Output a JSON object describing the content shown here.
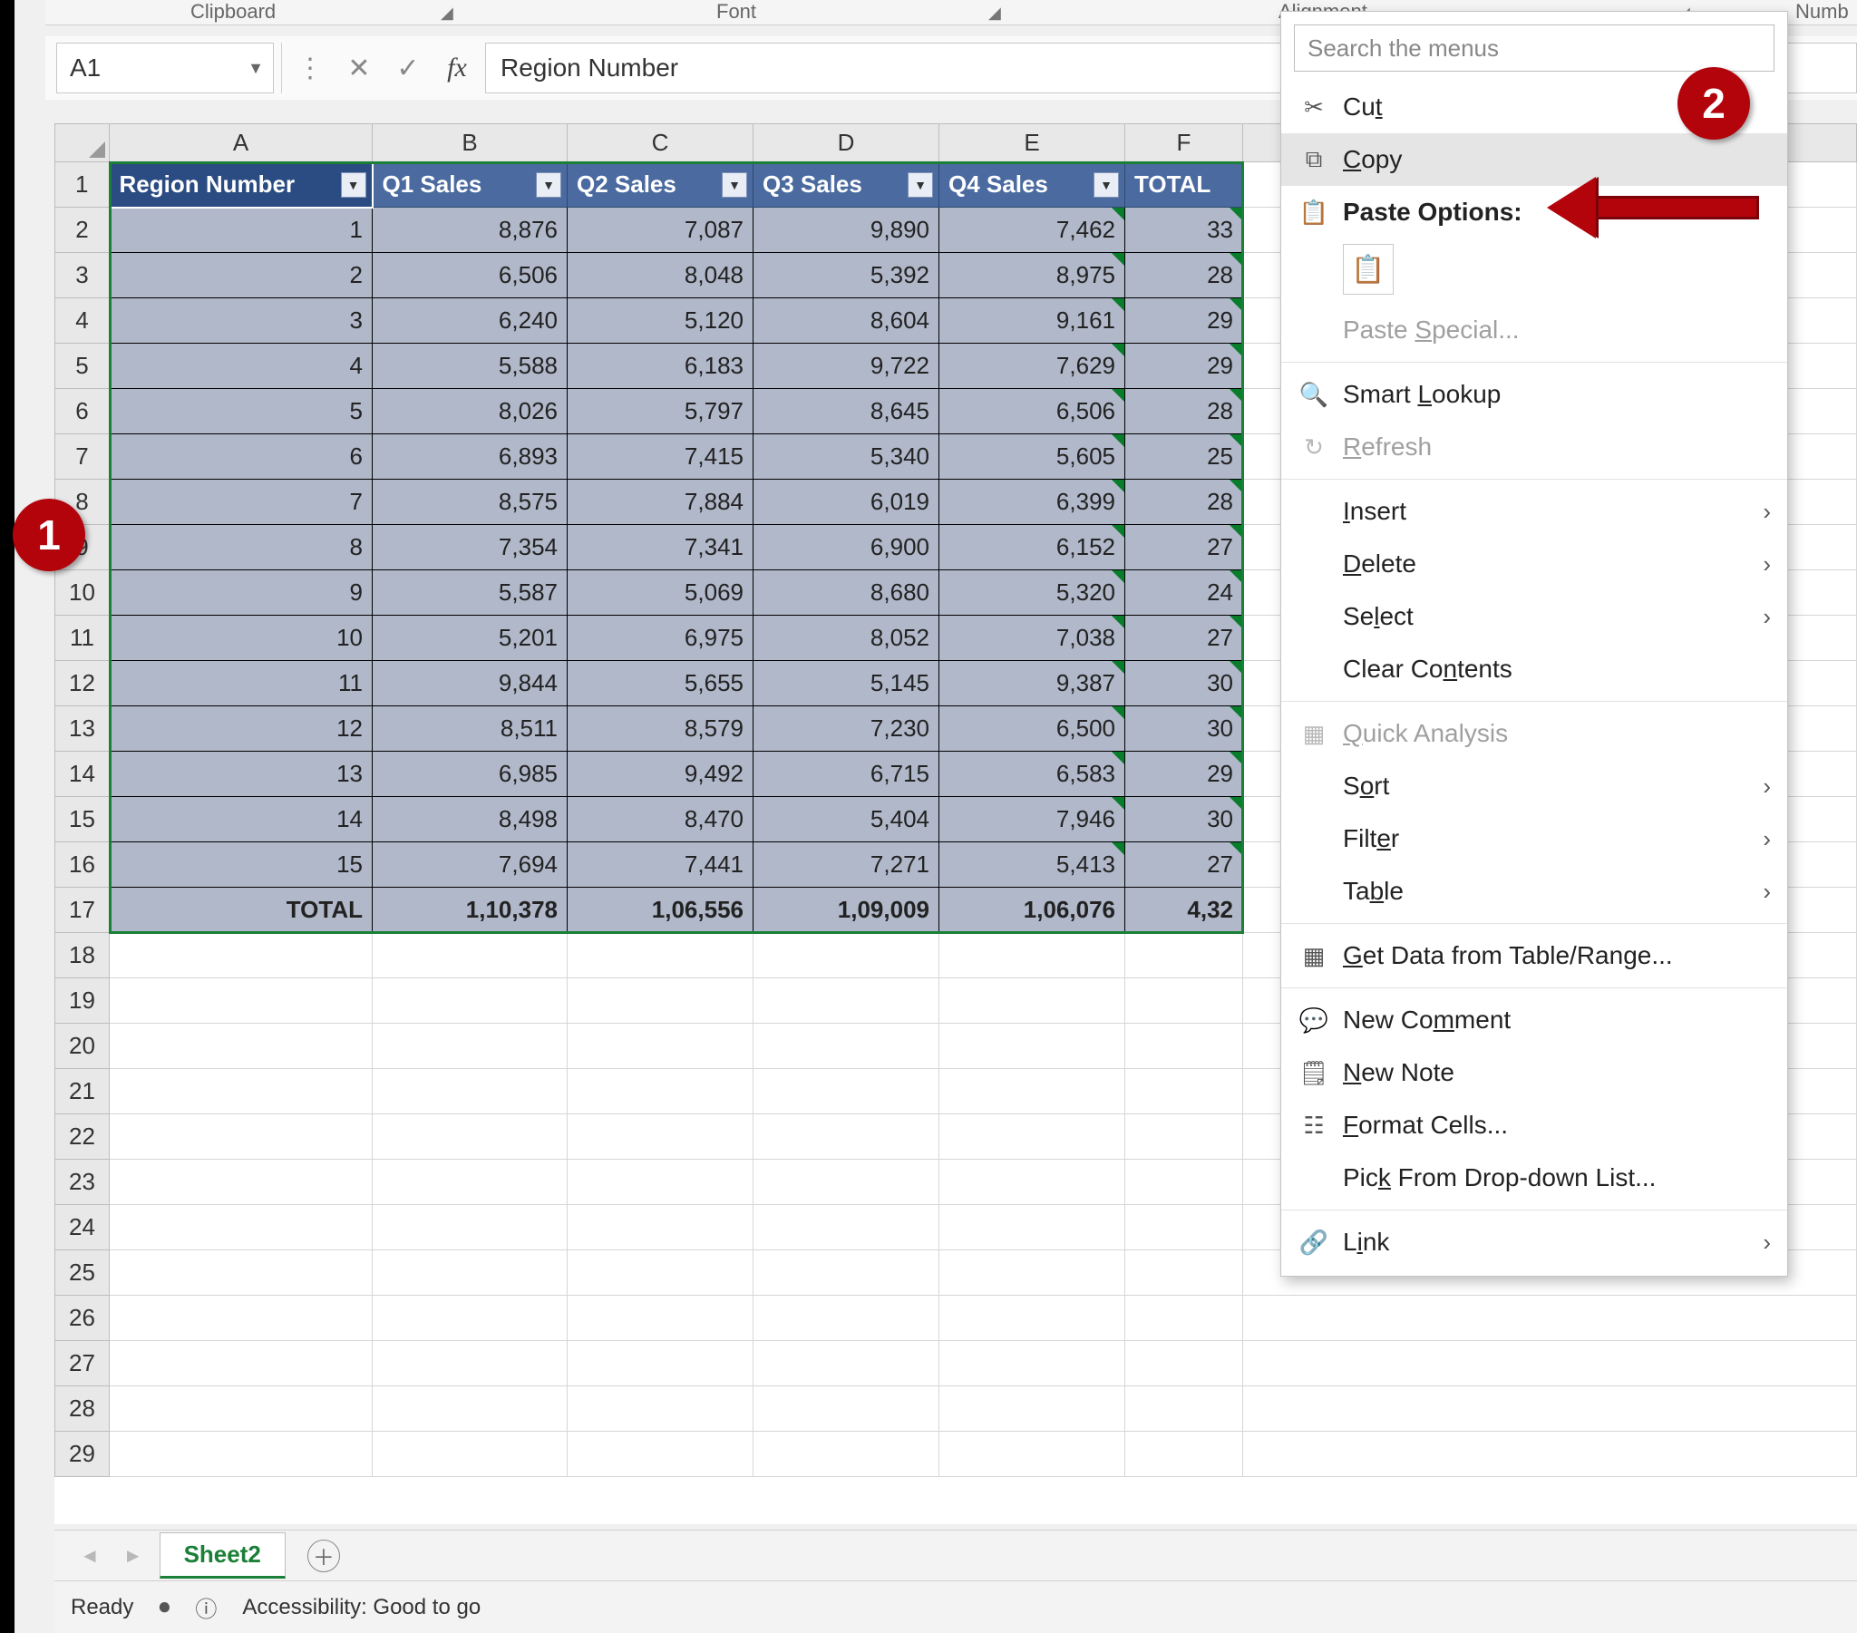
{
  "ribbon": {
    "groups": [
      "Clipboard",
      "Font",
      "Alignment",
      "Numb"
    ]
  },
  "nameBox": "A1",
  "formulaBar": "Region Number",
  "columns": [
    "A",
    "B",
    "C",
    "D",
    "E",
    "F"
  ],
  "tableHeaders": [
    "Region Number",
    "Q1 Sales",
    "Q2 Sales",
    "Q3 Sales",
    "Q4 Sales",
    "TOTAL"
  ],
  "rows": [
    {
      "region": "1",
      "q1": "8,876",
      "q2": "7,087",
      "q3": "9,890",
      "q4": "7,462",
      "total": "33"
    },
    {
      "region": "2",
      "q1": "6,506",
      "q2": "8,048",
      "q3": "5,392",
      "q4": "8,975",
      "total": "28"
    },
    {
      "region": "3",
      "q1": "6,240",
      "q2": "5,120",
      "q3": "8,604",
      "q4": "9,161",
      "total": "29"
    },
    {
      "region": "4",
      "q1": "5,588",
      "q2": "6,183",
      "q3": "9,722",
      "q4": "7,629",
      "total": "29"
    },
    {
      "region": "5",
      "q1": "8,026",
      "q2": "5,797",
      "q3": "8,645",
      "q4": "6,506",
      "total": "28"
    },
    {
      "region": "6",
      "q1": "6,893",
      "q2": "7,415",
      "q3": "5,340",
      "q4": "5,605",
      "total": "25"
    },
    {
      "region": "7",
      "q1": "8,575",
      "q2": "7,884",
      "q3": "6,019",
      "q4": "6,399",
      "total": "28"
    },
    {
      "region": "8",
      "q1": "7,354",
      "q2": "7,341",
      "q3": "6,900",
      "q4": "6,152",
      "total": "27"
    },
    {
      "region": "9",
      "q1": "5,587",
      "q2": "5,069",
      "q3": "8,680",
      "q4": "5,320",
      "total": "24"
    },
    {
      "region": "10",
      "q1": "5,201",
      "q2": "6,975",
      "q3": "8,052",
      "q4": "7,038",
      "total": "27"
    },
    {
      "region": "11",
      "q1": "9,844",
      "q2": "5,655",
      "q3": "5,145",
      "q4": "9,387",
      "total": "30"
    },
    {
      "region": "12",
      "q1": "8,511",
      "q2": "8,579",
      "q3": "7,230",
      "q4": "6,500",
      "total": "30"
    },
    {
      "region": "13",
      "q1": "6,985",
      "q2": "9,492",
      "q3": "6,715",
      "q4": "6,583",
      "total": "29"
    },
    {
      "region": "14",
      "q1": "8,498",
      "q2": "8,470",
      "q3": "5,404",
      "q4": "7,946",
      "total": "30"
    },
    {
      "region": "15",
      "q1": "7,694",
      "q2": "7,441",
      "q3": "7,271",
      "q4": "5,413",
      "total": "27"
    }
  ],
  "totalRow": {
    "label": "TOTAL",
    "q1": "1,10,378",
    "q2": "1,06,556",
    "q3": "1,09,009",
    "q4": "1,06,076",
    "total": "4,32"
  },
  "emptyRowStart": 18,
  "emptyRowEnd": 29,
  "contextMenu": {
    "searchPlaceholder": "Search the menus",
    "cut": "Cut",
    "copy": "Copy",
    "pasteOptionsTitle": "Paste Options:",
    "pasteSpecial": "Paste Special...",
    "smartLookup": "Smart Lookup",
    "refresh": "Refresh",
    "insert": "Insert",
    "delete": "Delete",
    "select": "Select",
    "clearContents": "Clear Contents",
    "quickAnalysis": "Quick Analysis",
    "sort": "Sort",
    "filter": "Filter",
    "table": "Table",
    "getData": "Get Data from Table/Range...",
    "newComment": "New Comment",
    "newNote": "New Note",
    "formatCells": "Format Cells...",
    "pickFromList": "Pick From Drop-down List...",
    "link": "Link"
  },
  "sheetTab": "Sheet2",
  "statusBar": {
    "ready": "Ready",
    "accessibility": "Accessibility: Good to go"
  },
  "callouts": {
    "one": "1",
    "two": "2"
  }
}
